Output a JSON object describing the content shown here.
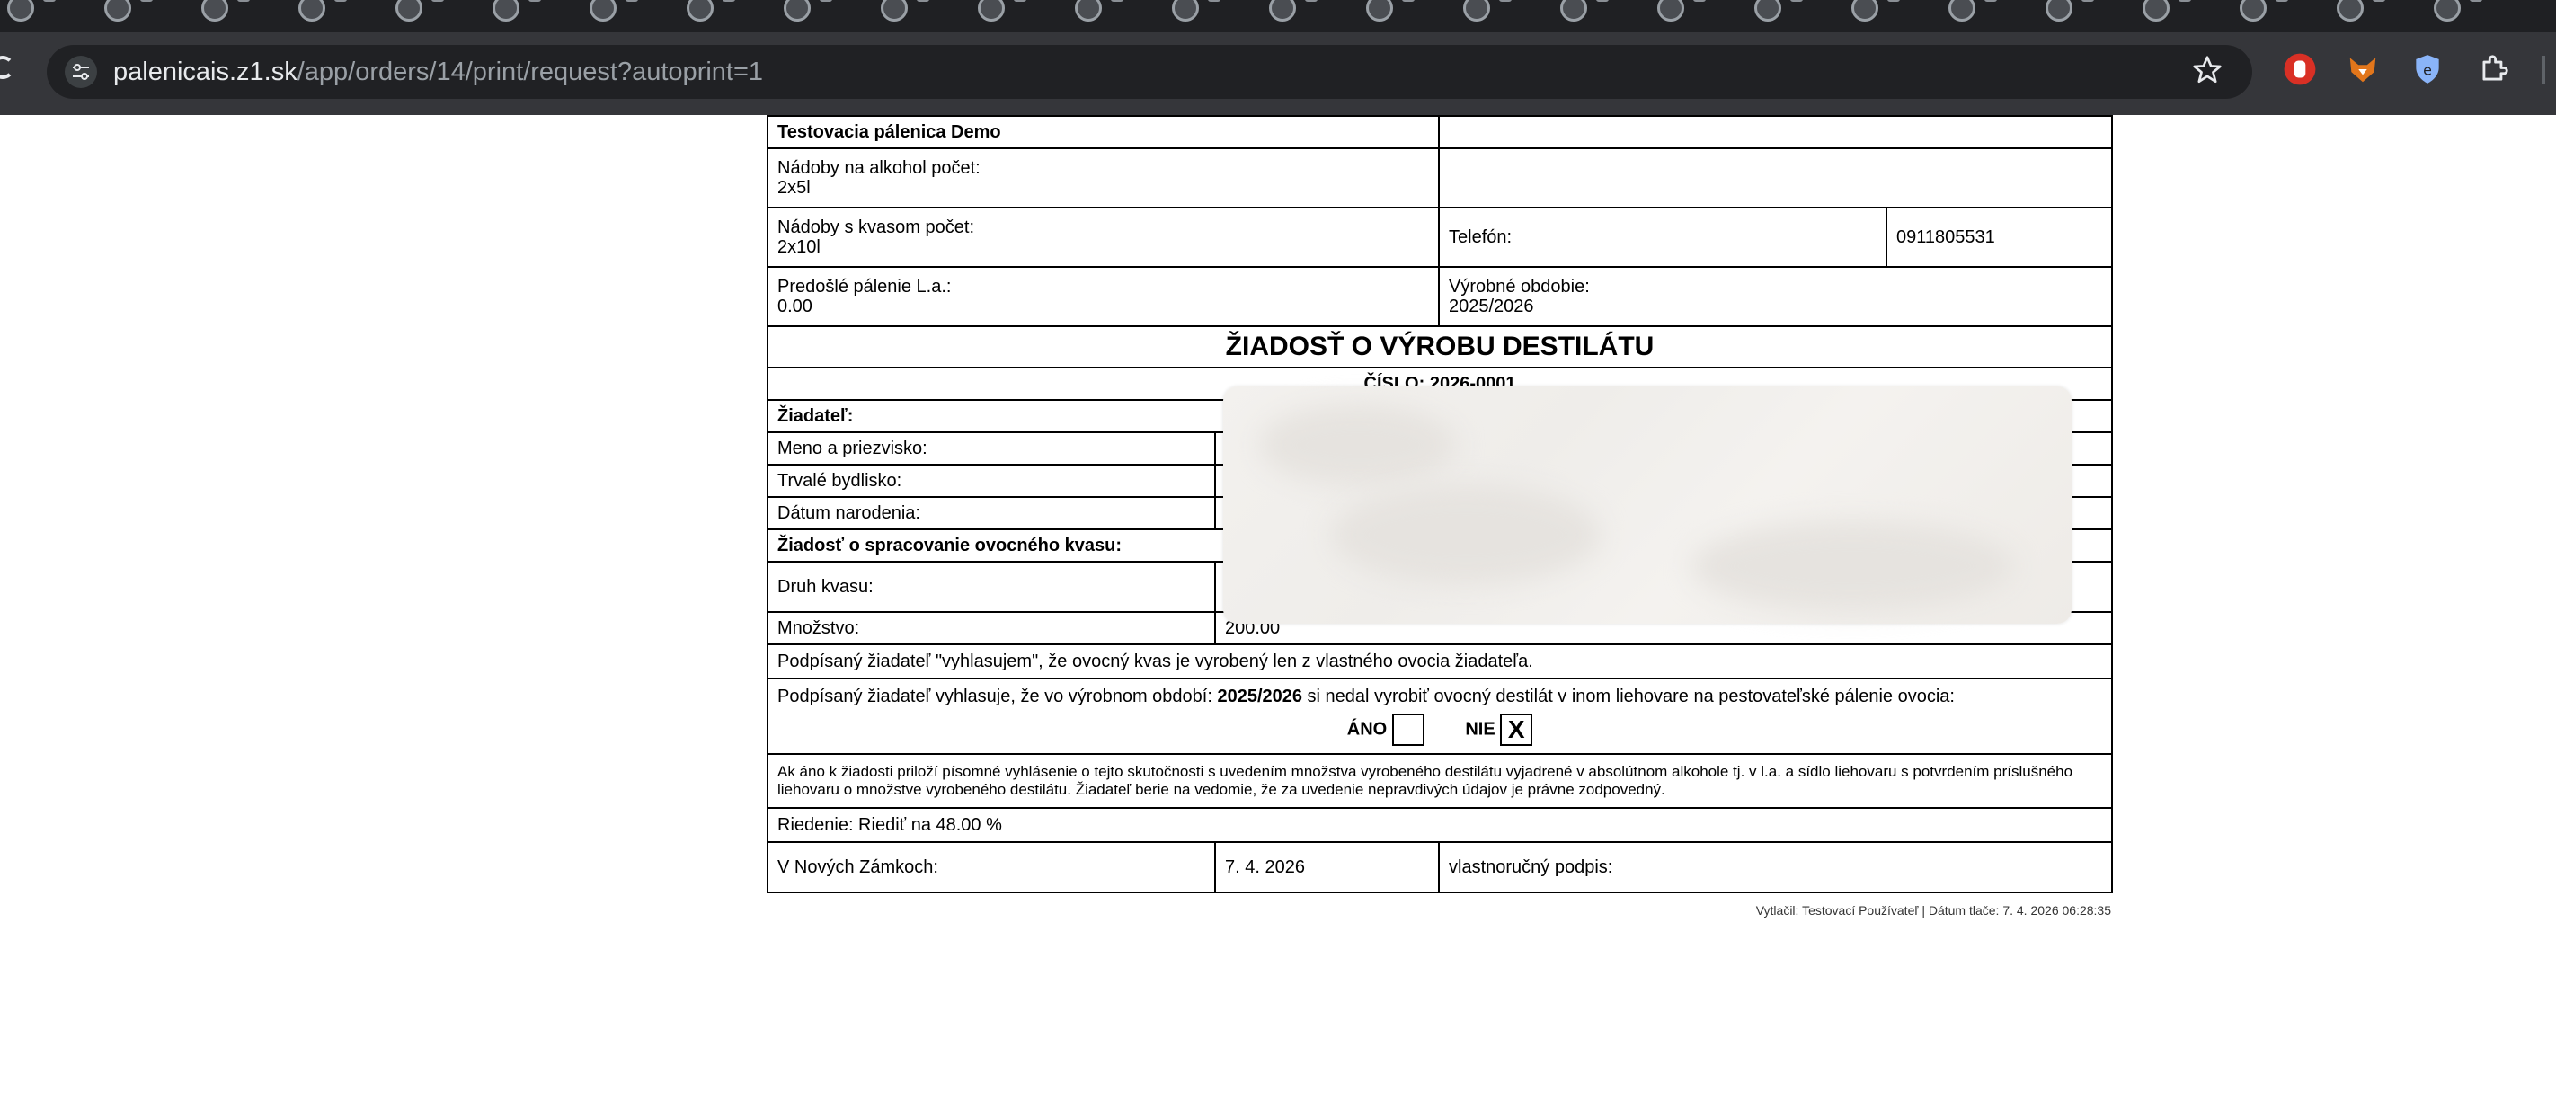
{
  "browser": {
    "url_host": "palenicais.z1.sk",
    "url_path": "/app/orders/14/print/request?autoprint=1",
    "tab_count": 26,
    "icons": {
      "reload": "reload-icon",
      "site_info": "tune-icon",
      "bookmark": "star-icon",
      "extensions": "puzzle-icon"
    }
  },
  "document": {
    "header": {
      "distillery_name": "Testovacia pálenica Demo",
      "vessels_alcohol_label": "Nádoby na alkohol počet:",
      "vessels_alcohol_value": "2x5l",
      "vessels_mash_label": "Nádoby s kvasom počet:",
      "vessels_mash_value": "2x10l",
      "phone_label": "Telefón:",
      "phone_value": "0911805531",
      "previous_la_label": "Predošlé pálenie L.a.:",
      "previous_la_value": "0.00",
      "period_label": "Výrobné obdobie:",
      "period_value": "2025/2026"
    },
    "title": "ŽIADOSŤ O VÝROBU DESTILÁTU",
    "number": "ČÍSLO: 2026-0001",
    "applicant_heading": "Žiadateľ:",
    "name_label": "Meno a priezvisko:",
    "address_label": "Trvalé bydlisko:",
    "birth_label": "Dátum narodenia:",
    "processing_heading": "Žiadosť o spracovanie ovocného kvasu:",
    "mash_type_label": "Druh kvasu:",
    "quantity_label": "Množstvo:",
    "quantity_value": "200.00",
    "declaration_own_fruit": "Podpísaný žiadateľ \"vyhlasujem\", že ovocný kvas je vyrobený len z vlastného ovocia žiadateľa.",
    "declaration_period_pre": "Podpísaný žiadateľ vyhlasuje, že vo výrobnom období: ",
    "declaration_period_value": "2025/2026",
    "declaration_period_post": " si nedal vyrobiť ovocný destilát v inom liehovare na pestovateľské pálenie ovocia:",
    "yes_label": "ÁNO",
    "yes_mark": "",
    "no_label": "NIE",
    "no_mark": "X",
    "note": "Ak áno k žiadosti priloží písomné vyhlásenie o tejto skutočnosti s uvedením množstva vyrobeného destilátu vyjadrené v absolútnom alkohole tj. v l.a. a sídlo liehovaru s potvrdením príslušného liehovaru o množstve vyrobeného destilátu. Žiadateľ berie na vedomie, že za uvedenie nepravdivých údajov je právne zodpovedný.",
    "dilution": "Riedenie: Riediť na 48.00 %",
    "place_label": "V Nových Zámkoch:",
    "date_value": "7. 4. 2026",
    "signature_label": "vlastnoručný podpis:",
    "print_footer": "Vytlačil: Testovací Používateľ | Dátum tlače: 7. 4. 2026 06:28:35"
  }
}
